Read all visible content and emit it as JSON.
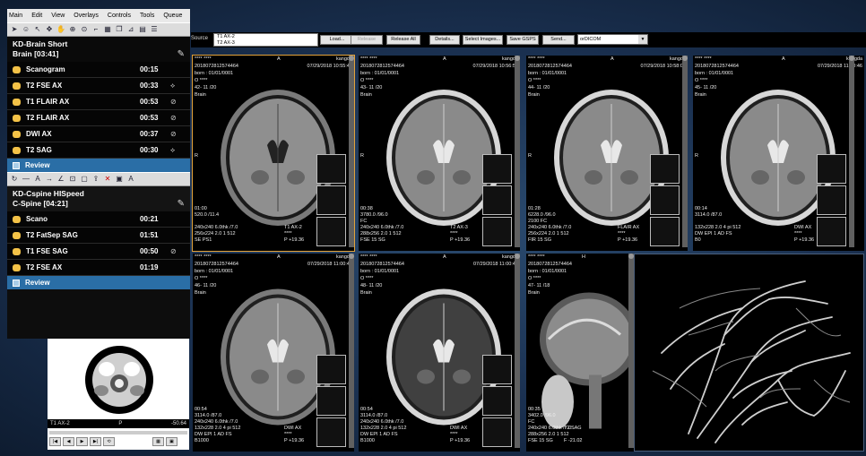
{
  "menu": [
    "Main",
    "Edit",
    "View",
    "Overlays",
    "Controls",
    "Tools",
    "Queue"
  ],
  "exam1": {
    "line1": "KD-Brain Short",
    "line2": "Brain  [03:41]",
    "sequences": [
      {
        "name": "Scanogram",
        "time": "00:15",
        "icon": ""
      },
      {
        "name": "T2 FSE AX",
        "time": "00:33",
        "icon": "⟡"
      },
      {
        "name": "T1 FLAIR AX",
        "time": "00:53",
        "icon": "⊘"
      },
      {
        "name": "T2 FLAIR AX",
        "time": "00:53",
        "icon": "⊘"
      },
      {
        "name": "DWI AX",
        "time": "00:37",
        "icon": "⊘"
      },
      {
        "name": "T2 SAG",
        "time": "00:30",
        "icon": "⟡"
      }
    ],
    "review": "Review"
  },
  "exam2": {
    "line1": "KD-Cspine HISpeed",
    "line2": "C-Spine  [04:21]",
    "sequences": [
      {
        "name": "Scano",
        "time": "00:21",
        "icon": ""
      },
      {
        "name": "T2 FatSep SAG",
        "time": "01:51",
        "icon": ""
      },
      {
        "name": "T1 FSE SAG",
        "time": "00:50",
        "icon": "⊘"
      },
      {
        "name": "T2 FSE AX",
        "time": "01:19",
        "icon": ""
      }
    ],
    "review": "Review"
  },
  "preview": {
    "label_left": "T1 AX-2",
    "label_mid": "P",
    "label_right": "-50.64"
  },
  "viewer": {
    "source_label": "Source",
    "source_items": [
      "T1 AX-2",
      "T2 AX-3"
    ],
    "buttons": [
      "Load...",
      "Release",
      "Release All",
      "Details...",
      "Select Images...",
      "Save GSPS",
      "Send..."
    ],
    "destination": "orDICOM"
  },
  "viewports": [
    {
      "name": "****  ****",
      "orient": "A",
      "user": "kangda",
      "id": "2018072812574464",
      "date": "07/29/2018 10:55:41",
      "born": "born : 01/01/0001",
      "sex": "O  ****",
      "slice": "42- 11 /20",
      "region": "Brain",
      "side": "R",
      "b1": "01:00",
      "b2": "520.0 /11.4",
      "b3": "",
      "b4": "240x240  6.0thk /7.0",
      "b5": "256x224  2.0  1  512",
      "b6": "SE  PS1",
      "seq": "T1 AX-2",
      "stars": "****",
      "pos": "P  +19.36"
    },
    {
      "name": "****  ****",
      "orient": "A",
      "user": "kangda",
      "id": "2018072812574464",
      "date": "07/29/2018 10:56:58",
      "born": "born : 01/01/0001",
      "sex": "O  ****",
      "slice": "43- 11 /20",
      "region": "Brain",
      "side": "R",
      "b1": "00:38",
      "b2": "3780.0 /96.0",
      "b3": "FC",
      "b4": "240x240  6.0thk /7.0",
      "b5": "288x256  2.0  1  512",
      "b6": "FSE  15  SG",
      "seq": "T2 AX-3",
      "stars": "****",
      "pos": "P  +19.36"
    },
    {
      "name": "****  ****",
      "orient": "A",
      "user": "kangda",
      "id": "2018072812574464",
      "date": "07/29/2018 10:58:07",
      "born": "born : 01/01/0001",
      "sex": "O  ****",
      "slice": "44- 11 /20",
      "region": "Brain",
      "side": "R",
      "b1": "01:28",
      "b2": "6228.0 /96.0",
      "b3": "2100  FC",
      "b4": "240x240  6.0thk /7.0",
      "b5": "256x224  2.0  1  512",
      "b6": "FIR  15  SG",
      "seq": "FLAIR AX",
      "stars": "****",
      "pos": "P  +19.36"
    },
    {
      "name": "****  ****",
      "orient": "A",
      "user": "kangda",
      "id": "2018072812574464",
      "date": "07/29/2018 11:00:46",
      "born": "born : 01/01/0001",
      "sex": "O  ****",
      "slice": "45- 11 /20",
      "region": "Brain",
      "side": "R",
      "b1": "00:14",
      "b2": "3114.0 /87.0",
      "b3": "",
      "b4": "132x228  2.0  4  pi 512",
      "b5": "DW EPI  1  AD  FS",
      "b6": "B0",
      "seq": "DWI AX",
      "stars": "****",
      "pos": "P  +19.36"
    },
    {
      "name": "****  ****",
      "orient": "A",
      "user": "kangda",
      "id": "2018072812574464",
      "date": "07/29/2018 11:00:46",
      "born": "born : 01/01/0001",
      "sex": "O  ****",
      "slice": "46- 11 /20",
      "region": "Brain",
      "side": "",
      "b1": "00:54",
      "b2": "3114.0 /87.0",
      "b3": "240x240  6.0thk /7.0",
      "b4": "132x228  2.0  4  pi 512",
      "b5": "DW EPI  1  AD  FS",
      "b6": "B1000",
      "seq": "DWI AX",
      "stars": "****",
      "pos": "P  +19.36"
    },
    {
      "name": "****  ****",
      "orient": "A",
      "user": "kangda",
      "id": "2018072812574464",
      "date": "07/29/2018 11:00:46",
      "born": "born : 01/01/0001",
      "sex": "O  ****",
      "slice": "48- 11 /20",
      "region": "Brain",
      "side": "",
      "b1": "00:54",
      "b2": "3114.0 /87.0",
      "b3": "240x240  6.0thk /7.0",
      "b4": "132x228  2.0  4  pi 512",
      "b5": "DW EPI  1  AD  FS",
      "b6": "B1000",
      "seq": "DWI AX",
      "stars": "****",
      "pos": "P  +19.36"
    },
    {
      "name": "****  ****",
      "orient": "H",
      "user": "",
      "id": "2018072812574464",
      "date": "",
      "born": "born : 01/01/0001",
      "sex": "O  ****",
      "slice": "47- 11 /18",
      "region": "Brain",
      "side": "",
      "b1": "00:35",
      "b2": "3402.0 /96.0",
      "b3": "FC",
      "b4": "240x240  6.0thk /7.0",
      "b5": "288x256  2.0  1  512",
      "b6": "FSE  15  SG",
      "seq": "T2 SAG",
      "stars": "",
      "pos": "F  -21.02"
    }
  ],
  "colors": {
    "accent_yellow": "#f4c247",
    "review_blue": "#2a6ea6",
    "active_frame": "#e2a23a"
  }
}
